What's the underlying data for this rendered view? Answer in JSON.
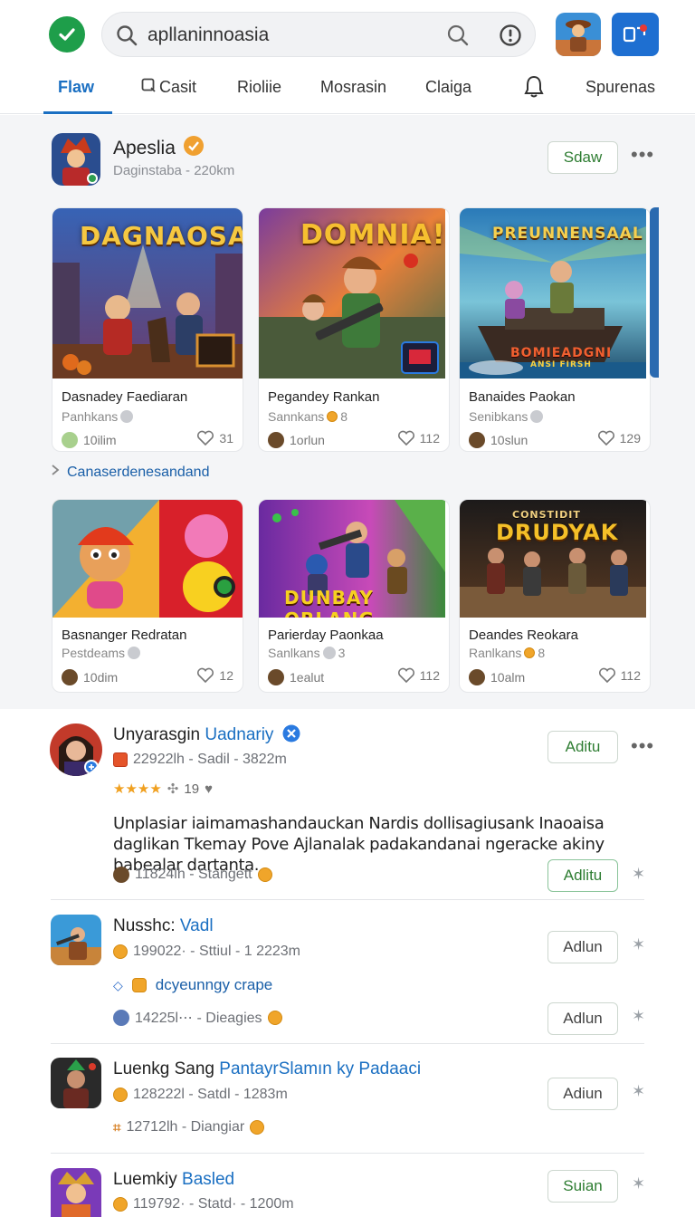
{
  "search": {
    "value": "apllaninnoasia"
  },
  "tabs": [
    {
      "label": "Flaw"
    },
    {
      "label": "Casit"
    },
    {
      "label": "Rioliie"
    },
    {
      "label": "Mosrasin"
    },
    {
      "label": "Claiga"
    },
    {
      "label": "Spurenas"
    }
  ],
  "publisher": {
    "name": "Apeslia",
    "subtitle": "Daginstaba - 220km",
    "follow_label": "Sdaw"
  },
  "cards_row1": [
    {
      "art_title": "DAGNAOSA",
      "title": "Dasnadey Faediaran",
      "sub": "Panhkans",
      "meta": "10ilim",
      "likes": "31"
    },
    {
      "art_title": "DOMNIA!",
      "title": "Pegandey Rankan",
      "sub": "Sannkans",
      "sub_num": "8",
      "meta": "1orlun",
      "likes": "112"
    },
    {
      "art_title": "PREUNNENSAAL",
      "art_caption": "BOMIEADGNI",
      "art_caption2": "ANSI FIRSH",
      "title": "Banaides Paokan",
      "sub": "Senibkans",
      "meta": "10slun",
      "likes": "129"
    }
  ],
  "more_link": "Canaserdenesandand",
  "cards_row2": [
    {
      "title": "Basnanger Redratan",
      "sub": "Pestdeams",
      "meta": "10dim",
      "likes": "12"
    },
    {
      "art_title": "DUNBAY ORLANG",
      "title": "Parierday Paonkaa",
      "sub": "Sanlkans",
      "sub_num": "3",
      "meta": "1ealut",
      "likes": "112"
    },
    {
      "art_title": "DRUDYAK",
      "art_caption": "CONSTIDIT",
      "title": "Deandes Reokara",
      "sub": "Ranlkans",
      "sub_num": "8",
      "meta": "10alm",
      "likes": "112"
    }
  ],
  "feed": [
    {
      "name_plain": "Unyarasgin ",
      "name_highlight": "Uadnariy",
      "meta": "22922lh - Sadil - 3822m",
      "rating_count": "19",
      "body": "Unplasiar iaimamashandauckan Nardis dollisagiusank Inaoaisa daglikan Tkemay Pove Ajlanalak padakandanai ngeracke akiny babealar dartanta.",
      "footer_meta": "11824lh - Stangett",
      "action_label": "Aditu",
      "footer_action_label": "Adlitu"
    },
    {
      "name_plain": "Nusshc: ",
      "name_highlight": "Vadl",
      "meta": "199022· - Sttiul - 1 2223m",
      "action_label": "Adlun",
      "tag": "dcyeunngy crape",
      "footer_meta": "14225l⋯ - Dieagies",
      "footer_action_label": "Adlun"
    },
    {
      "name_plain": "Luenkg Sang ",
      "name_highlight": "PantayrSlamın ky Padaaci",
      "meta": "128222l - Satdl - 1283m",
      "action_label": "Adiun",
      "footer_meta": "12712lh - Diangiar"
    },
    {
      "name_plain": "Luemkiy ",
      "name_highlight": "Basled",
      "meta": "119792· - Statd· - 1200m",
      "action_label": "Suian"
    }
  ],
  "colors": {
    "accent": "#1a6fc2",
    "green": "#2e7d32",
    "check": "#1e9e4a"
  }
}
